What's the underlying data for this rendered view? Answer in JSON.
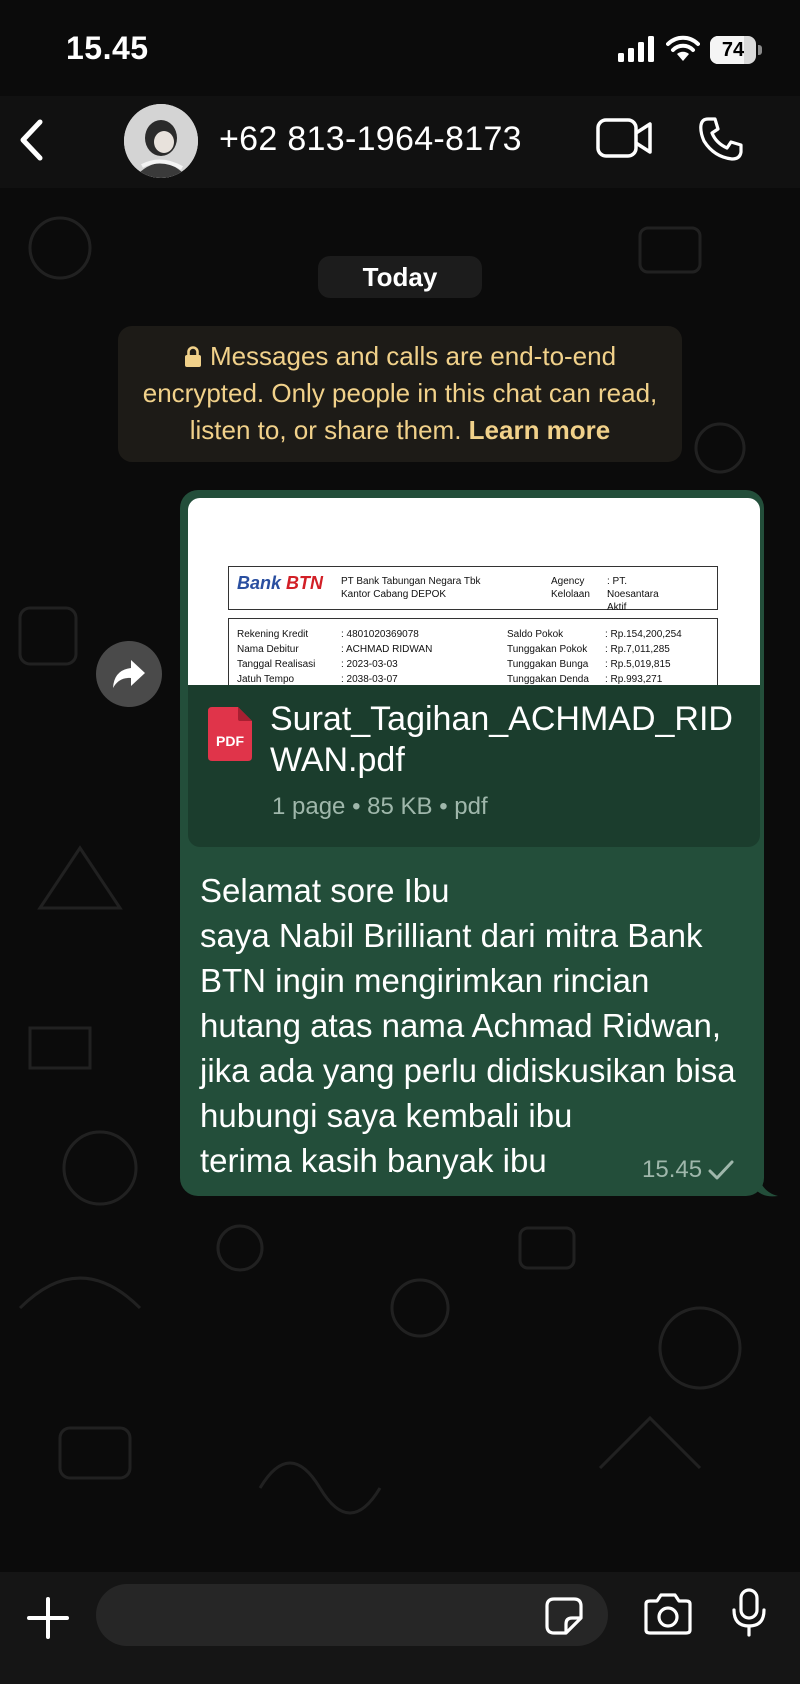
{
  "status_bar": {
    "time": "15.45",
    "battery": "74",
    "battery_level": 0.74
  },
  "header": {
    "contact": "+62 813-1964-8173"
  },
  "chat": {
    "date_label": "Today",
    "encryption_notice": "Messages and calls are end-to-end encrypted. Only people in this chat can read, listen to, or share them.",
    "learn_more": "Learn more",
    "message": {
      "preview": {
        "logo_bank": "Bank",
        "logo_btn": "BTN",
        "company": "PT Bank Tabungan Negara Tbk",
        "branch": "Kantor Cabang DEPOK",
        "agency_label": "Agency",
        "agency_value": ": PT. Noesantara",
        "kelolaan_label": "Kelolaan",
        "kelolaan_value": ": Aktif",
        "rows": [
          {
            "l1": "Rekening Kredit",
            "v1": ": 4801020369078",
            "l2": "Saldo Pokok",
            "v2": ": Rp.154,200,254"
          },
          {
            "l1": "Nama Debitur",
            "v1": ": ACHMAD RIDWAN",
            "l2": "Tunggakan Pokok",
            "v2": ": Rp.7,011,285"
          },
          {
            "l1": "Tanggal Realisasi",
            "v1": ": 2023-03-03",
            "l2": "Tunggakan Bunga",
            "v2": ": Rp.5,019,815"
          },
          {
            "l1": "Jatuh Tempo",
            "v1": ": 2038-03-07",
            "l2": "Tunggakan Denda",
            "v2": ": Rp.993,271"
          }
        ]
      },
      "file_badge": "PDF",
      "file_name": "Surat_Tagihan_ACHMAD_RIDWAN.pdf",
      "file_meta": "1 page • 85 KB • pdf",
      "text": "Selamat sore Ibu\nsaya Nabil Brilliant dari mitra Bank BTN ingin mengirimkan rincian hutang atas nama Achmad Ridwan, jika ada yang perlu didiskusikan bisa hubungi saya kembali ibu\nterima kasih banyak ibu",
      "time": "15.45"
    }
  },
  "input": {
    "placeholder": ""
  },
  "colors": {
    "bubble": "#234e3a",
    "file_row": "#1b3d2d",
    "notice_text": "#f1d18a",
    "background": "#0b0b0b"
  }
}
